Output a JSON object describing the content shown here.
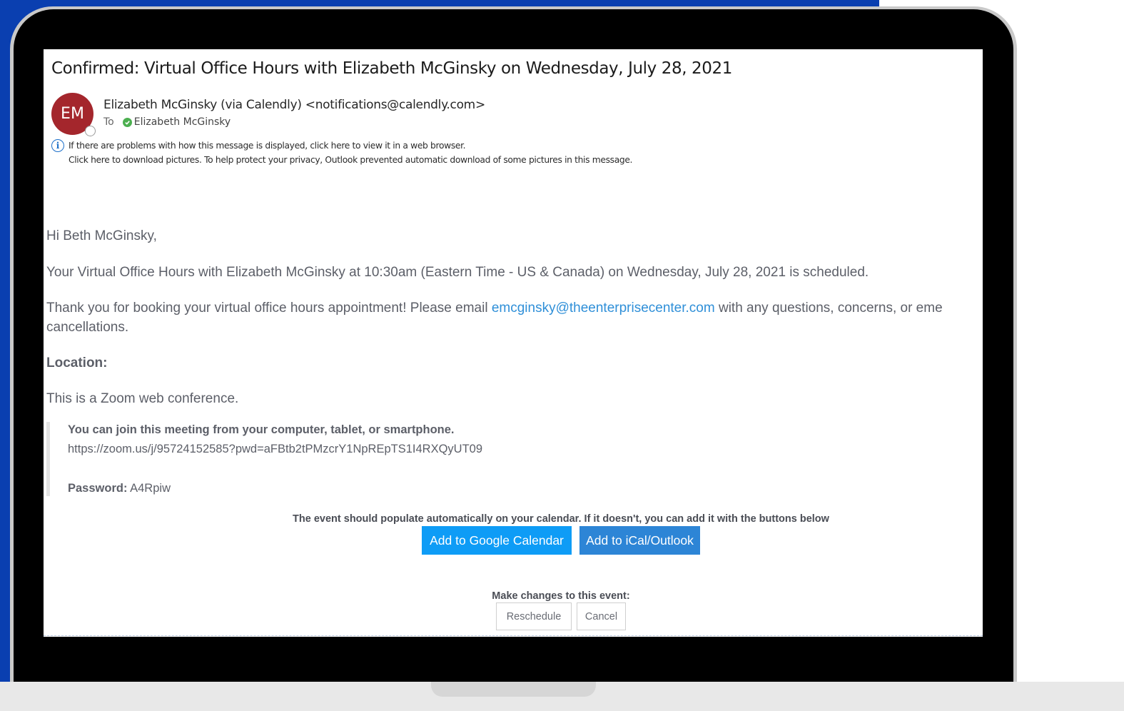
{
  "email": {
    "subject": "Confirmed: Virtual Office Hours with Elizabeth McGinsky on Wednesday, July 28, 2021",
    "avatar_initials": "EM",
    "sender": "Elizabeth McGinsky (via Calendly) <notifications@calendly.com>",
    "to_label": "To",
    "recipient": "Elizabeth McGinsky",
    "info_line_1": "If there are problems with how this message is displayed, click here to view it in a web browser.",
    "info_line_2": "Click here to download pictures. To help protect your privacy, Outlook prevented automatic download of some pictures in this message."
  },
  "body": {
    "greeting": "Hi Beth McGinsky,",
    "scheduled": "Your Virtual Office Hours with Elizabeth McGinsky at 10:30am (Eastern Time - US & Canada) on Wednesday, July 28, 2021 is scheduled.",
    "thanks_pre": "Thank you for booking your virtual office hours appointment! Please email ",
    "email_link": "emcginsky@theenterprisecenter.com",
    "thanks_post": " with any questions, concerns, or eme",
    "thanks_line2": "cancellations.",
    "location_label": "Location:",
    "location_desc": "This is a Zoom web conference.",
    "join_text": "You can join this meeting from your computer, tablet, or smartphone.",
    "zoom_link": "https://zoom.us/j/95724152585?pwd=aFBtb2tPMzcrY1NpREpTS1I4RXQyUT09",
    "password_label": "Password:",
    "password_value": " A4Rpiw",
    "calendar_note": "The event should populate automatically on your calendar. If it doesn't, you can add it with the buttons below",
    "google_button": "Add to Google Calendar",
    "ical_button": "Add to iCal/Outlook",
    "changes_label": "Make changes to this event:",
    "reschedule_button": "Reschedule",
    "cancel_button": "Cancel"
  },
  "colors": {
    "background_blue": "#0a3fb0",
    "avatar": "#a4262c",
    "google_button": "#0e9cf6",
    "ical_button": "#2d85d6",
    "link": "#2f8fd8"
  }
}
